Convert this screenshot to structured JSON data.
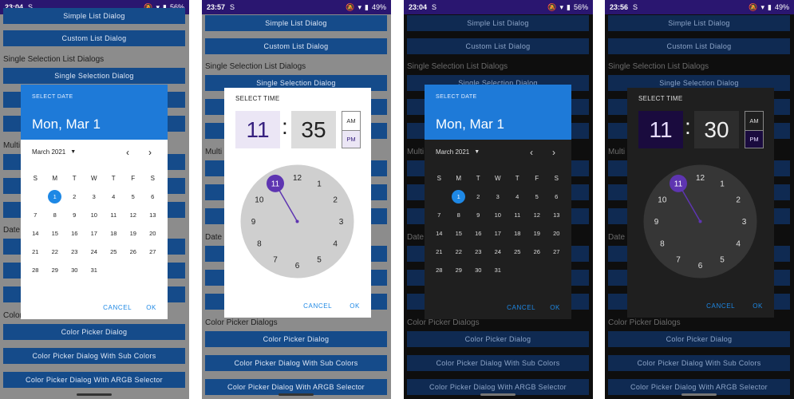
{
  "screens": [
    {
      "status": {
        "time": "23:04",
        "sim": "S",
        "battery": "56%"
      },
      "theme": "light",
      "buttons_top": [
        "Simple List Dialog",
        "Custom List Dialog"
      ],
      "section_single": "Single Selection List Dialogs",
      "button_single": "Single Selection Dialog",
      "peek_multi": "Multi",
      "peek_date": "Date",
      "peek_color": "Color",
      "bottom_buttons": [
        "Color Picker Dialog",
        "Color Picker Dialog With Sub Colors",
        "Color Picker Dialog With ARGB Selector"
      ]
    },
    {
      "status": {
        "time": "23:57",
        "sim": "S",
        "battery": "49%"
      },
      "theme": "light",
      "buttons_top": [
        "Simple List Dialog",
        "Custom List Dialog"
      ],
      "section_single": "Single Selection List Dialogs",
      "button_single": "Single Selection Dialog",
      "peek_multi": "Multi",
      "peek_date": "Date",
      "section_color": "Color Picker Dialogs",
      "bottom_buttons": [
        "Color Picker Dialog",
        "Color Picker Dialog With Sub Colors",
        "Color Picker Dialog With ARGB Selector"
      ]
    },
    {
      "status": {
        "time": "23:04",
        "sim": "S",
        "battery": "56%"
      },
      "theme": "dark",
      "buttons_top": [
        "Simple List Dialog",
        "Custom List Dialog"
      ],
      "section_single": "Single Selection List Dialogs",
      "button_single": "Single Selection Dialog",
      "peek_multi": "Multi",
      "peek_date": "Date",
      "section_color": "Color Picker Dialogs",
      "bottom_buttons": [
        "Color Picker Dialog",
        "Color Picker Dialog With Sub Colors",
        "Color Picker Dialog With ARGB Selector"
      ]
    },
    {
      "status": {
        "time": "23:56",
        "sim": "S",
        "battery": "49%"
      },
      "theme": "dark",
      "buttons_top": [
        "Simple List Dialog",
        "Custom List Dialog"
      ],
      "section_single": "Single Selection List Dialogs",
      "button_single": "Single Selection Dialog",
      "peek_multi": "Multi",
      "peek_date": "Date",
      "section_color": "Color Picker Dialogs",
      "bottom_buttons": [
        "Color Picker Dialog",
        "Color Picker Dialog With Sub Colors",
        "Color Picker Dialog With ARGB Selector"
      ]
    }
  ],
  "date_dialog": {
    "label": "SELECT DATE",
    "date": "Mon, Mar 1",
    "month": "March 2021",
    "weekdays": [
      "S",
      "M",
      "T",
      "W",
      "T",
      "F",
      "S"
    ],
    "weeks": [
      [
        "",
        "1",
        "2",
        "3",
        "4",
        "5",
        "6"
      ],
      [
        "7",
        "8",
        "9",
        "10",
        "11",
        "12",
        "13"
      ],
      [
        "14",
        "15",
        "16",
        "17",
        "18",
        "19",
        "20"
      ],
      [
        "21",
        "22",
        "23",
        "24",
        "25",
        "26",
        "27"
      ],
      [
        "28",
        "29",
        "30",
        "31",
        "",
        "",
        ""
      ]
    ],
    "selected_day": "1",
    "cancel": "CANCEL",
    "ok": "OK"
  },
  "time_dialogs": [
    {
      "label": "SELECT TIME",
      "hour": "11",
      "minute": "35",
      "am": "AM",
      "pm": "PM",
      "cancel": "CANCEL",
      "ok": "OK"
    },
    {
      "label": "SELECT TIME",
      "hour": "11",
      "minute": "30",
      "am": "AM",
      "pm": "PM",
      "cancel": "CANCEL",
      "ok": "OK"
    }
  ],
  "clock_numbers": [
    "12",
    "1",
    "2",
    "3",
    "4",
    "5",
    "6",
    "7",
    "8",
    "9",
    "10",
    "11"
  ],
  "colors": {
    "accent": "#1e88e5",
    "clock_selector": "#5e35b1",
    "header": "#1e7ad8"
  }
}
